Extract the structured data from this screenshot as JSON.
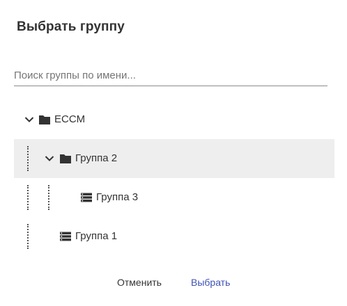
{
  "dialog": {
    "title": "Выбрать группу"
  },
  "search": {
    "placeholder": "Поиск группы по имени...",
    "value": ""
  },
  "tree": {
    "nodes": [
      {
        "label": "ECCM",
        "type": "folder",
        "expanded": true,
        "level": 0
      },
      {
        "label": "Группа 2",
        "type": "folder",
        "expanded": true,
        "level": 1,
        "selected": true
      },
      {
        "label": "Группа 3",
        "type": "group",
        "level": 2
      },
      {
        "label": "Группа 1",
        "type": "group",
        "level": 1
      }
    ]
  },
  "icons": {
    "expand": "chevron-down-icon",
    "folder": "folder-icon",
    "group": "list-icon"
  },
  "actions": {
    "cancel_label": "Отменить",
    "select_label": "Выбрать"
  },
  "colors": {
    "primary": "#3f51b5",
    "selected_row": "#eeeeee",
    "text": "#333333"
  }
}
